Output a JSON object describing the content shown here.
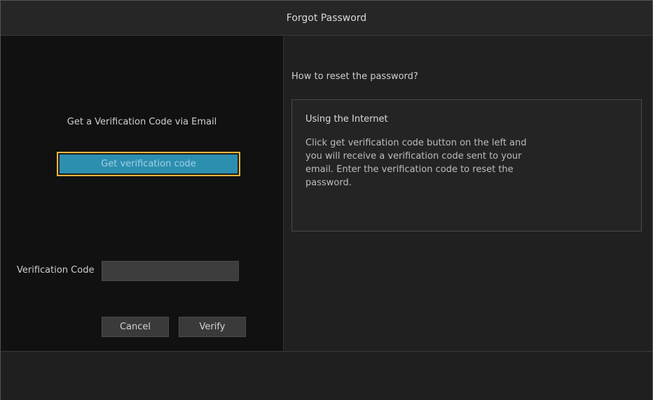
{
  "window": {
    "title": "Forgot Password"
  },
  "left": {
    "email_label": "Get a Verification Code via Email",
    "get_code_button": "Get verification code",
    "code_label": "Verification Code",
    "code_input_value": "",
    "cancel_button": "Cancel",
    "verify_button": "Verify"
  },
  "right": {
    "howto_label": "How to reset the password?",
    "info_title": "Using the Internet",
    "info_body": "Click get verification code button on the left and you will receive a verification code sent to your email. Enter the verification code to reset the password."
  },
  "colors": {
    "accent_button": "#2d8fb0",
    "focus_border": "#e8b63a",
    "background": "#1f1f1f"
  }
}
